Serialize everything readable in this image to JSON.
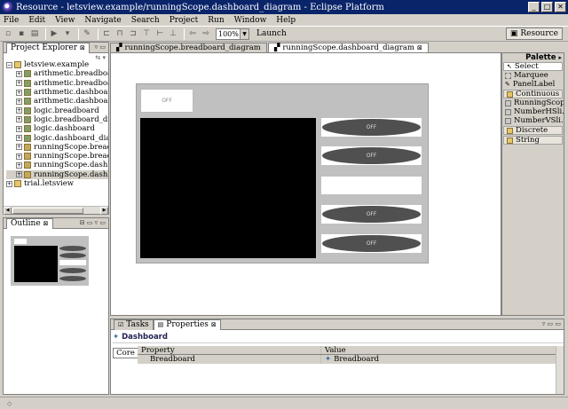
{
  "window": {
    "title": "Resource - letsview.example/runningScope.dashboard_diagram - Eclipse Platform"
  },
  "menu": [
    "File",
    "Edit",
    "View",
    "Navigate",
    "Search",
    "Project",
    "Run",
    "Window",
    "Help"
  ],
  "toolbar": {
    "zoom": "100%",
    "launch": "Launch",
    "perspective": "Resource"
  },
  "project_explorer": {
    "title": "Project Explorer",
    "root": "letsview.example",
    "files": [
      "arithmetic.breadboard",
      "arithmetic.breadboard_d",
      "arithmetic.dashboard",
      "arithmetic.dashboard_di",
      "logic.breadboard",
      "logic.breadboard_diagr",
      "logic.dashboard",
      "logic.dashboard_diagra",
      "runningScope.breadboa",
      "runningScope.breadboa",
      "runningScope.dashboar",
      "runningScope.dashboar"
    ],
    "second_project": "trial.letsview"
  },
  "outline": {
    "title": "Outline"
  },
  "editor": {
    "tabs": [
      "runningScope.breadboard_diagram",
      "runningScope.dashboard_diagram"
    ],
    "active_tab": 1,
    "dashboard": {
      "top_button": "OFF",
      "leds": [
        "OFF",
        "OFF",
        "OFF",
        "OFF"
      ]
    }
  },
  "palette": {
    "title": "Palette",
    "tools": [
      "Select",
      "Marquee",
      "PanelLabel"
    ],
    "drawers": [
      {
        "label": "Continuous",
        "items": [
          "RunningScope",
          "NumberHSli...",
          "NumberVSli..."
        ]
      },
      {
        "label": "Discrete",
        "items": []
      },
      {
        "label": "String",
        "items": []
      }
    ]
  },
  "bottom": {
    "tabs": [
      "Tasks",
      "Properties"
    ],
    "breadcrumb": "Dashboard",
    "core_tab": "Core",
    "columns": [
      "Property",
      "Value"
    ],
    "rows": [
      {
        "property": "Breadboard",
        "value": "Breadboard"
      }
    ]
  }
}
